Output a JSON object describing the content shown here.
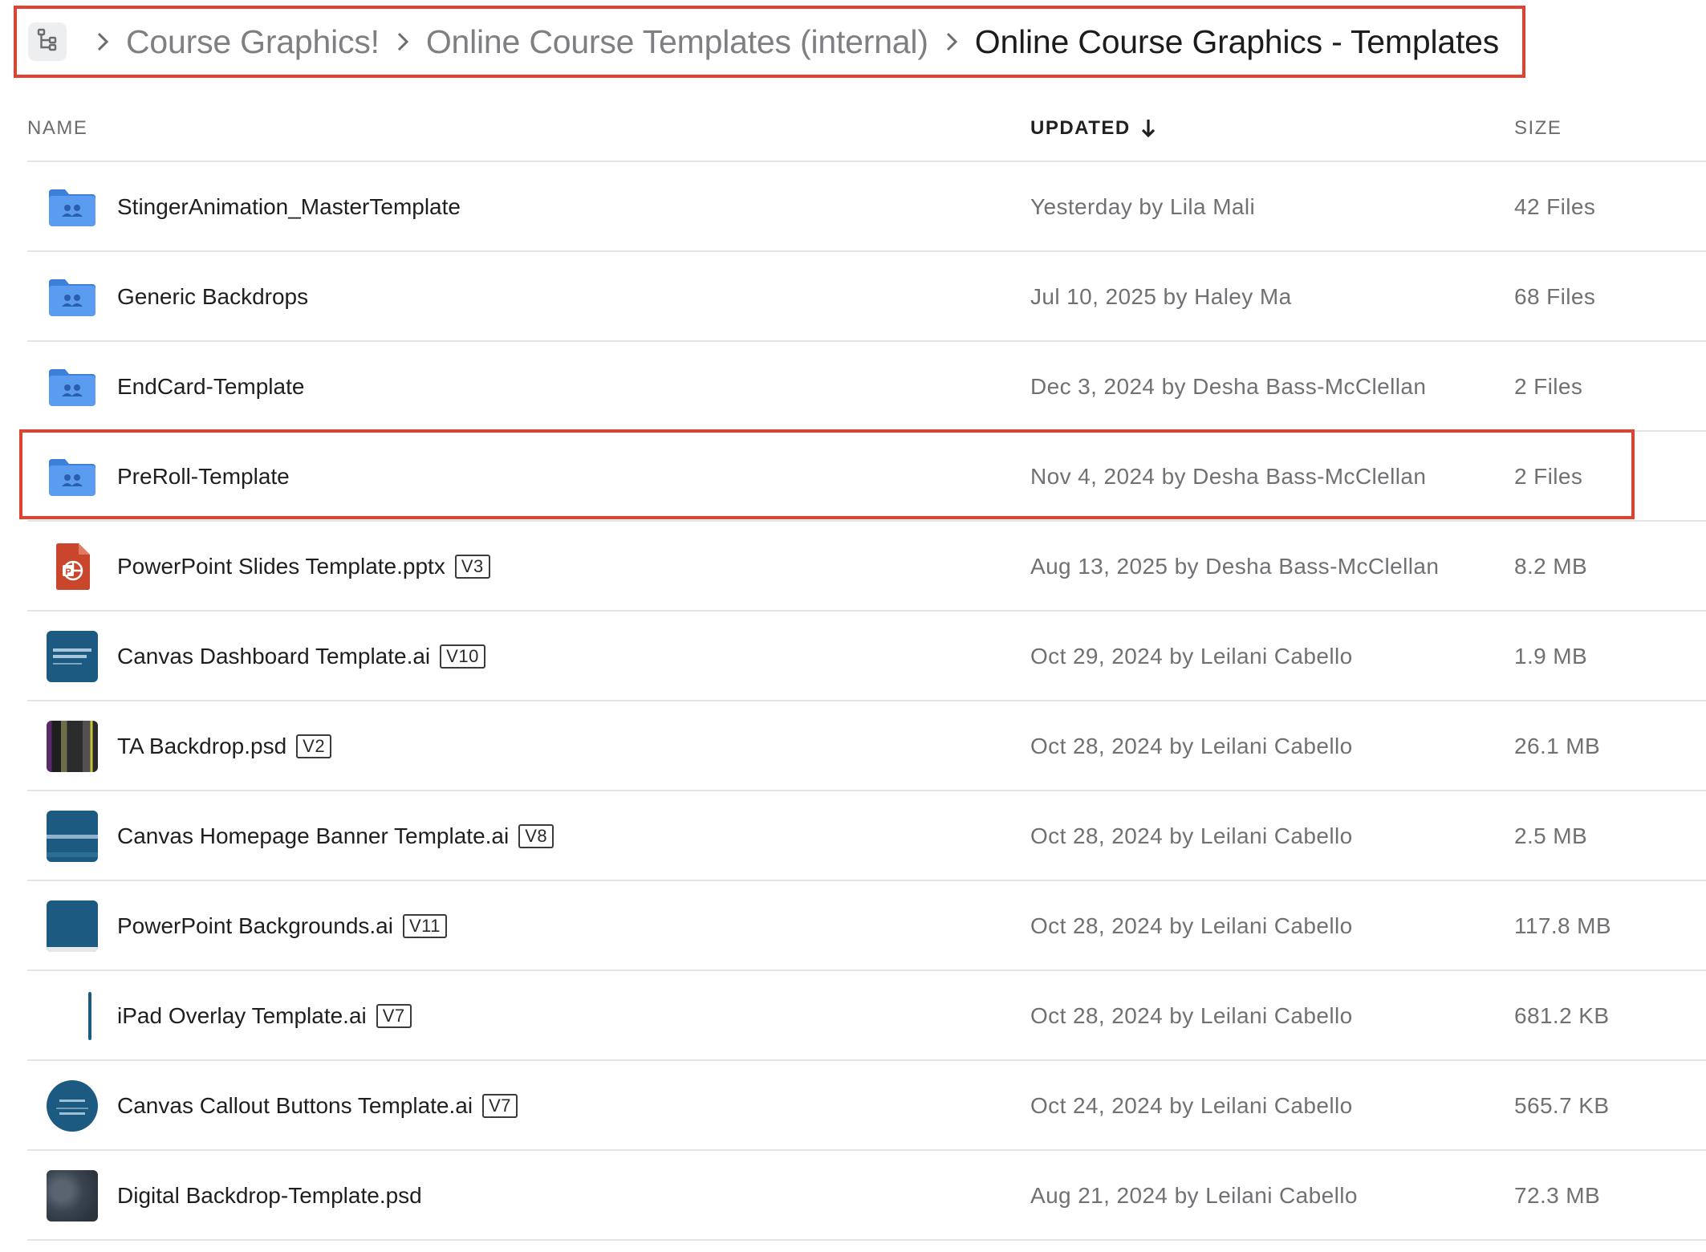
{
  "breadcrumb": {
    "items": [
      {
        "label": "Course Graphics!"
      },
      {
        "label": "Online Course Templates (internal)"
      },
      {
        "label": "Online Course Graphics - Templates"
      }
    ]
  },
  "columns": {
    "name": "NAME",
    "updated": "UPDATED",
    "size": "SIZE"
  },
  "rows": [
    {
      "name": "StingerAnimation_MasterTemplate",
      "version": "",
      "updated": "Yesterday by Lila Mali",
      "size": "42 Files",
      "icon": "shared-folder-icon"
    },
    {
      "name": "Generic Backdrops",
      "version": "",
      "updated": "Jul 10, 2025 by Haley Ma",
      "size": "68 Files",
      "icon": "shared-folder-icon"
    },
    {
      "name": "EndCard-Template",
      "version": "",
      "updated": "Dec 3, 2024 by Desha Bass-McClellan",
      "size": "2 Files",
      "icon": "shared-folder-icon"
    },
    {
      "name": "PreRoll-Template",
      "version": "",
      "updated": "Nov 4, 2024 by Desha Bass-McClellan",
      "size": "2 Files",
      "icon": "shared-folder-icon",
      "highlighted": true
    },
    {
      "name": "PowerPoint Slides Template.pptx",
      "version": "V3",
      "updated": "Aug 13, 2025 by Desha Bass-McClellan",
      "size": "8.2 MB",
      "icon": "powerpoint-file-icon"
    },
    {
      "name": "Canvas Dashboard Template.ai",
      "version": "V10",
      "updated": "Oct 29, 2024 by Leilani Cabello",
      "size": "1.9 MB",
      "icon": "file-thumbnail"
    },
    {
      "name": "TA Backdrop.psd",
      "version": "V2",
      "updated": "Oct 28, 2024 by Leilani Cabello",
      "size": "26.1 MB",
      "icon": "file-thumbnail"
    },
    {
      "name": "Canvas Homepage Banner Template.ai",
      "version": "V8",
      "updated": "Oct 28, 2024 by Leilani Cabello",
      "size": "2.5 MB",
      "icon": "file-thumbnail"
    },
    {
      "name": "PowerPoint Backgrounds.ai",
      "version": "V11",
      "updated": "Oct 28, 2024 by Leilani Cabello",
      "size": "117.8 MB",
      "icon": "file-thumbnail"
    },
    {
      "name": "iPad Overlay Template.ai",
      "version": "V7",
      "updated": "Oct 28, 2024 by Leilani Cabello",
      "size": "681.2 KB",
      "icon": "file-thumbnail"
    },
    {
      "name": "Canvas Callout Buttons Template.ai",
      "version": "V7",
      "updated": "Oct 24, 2024 by Leilani Cabello",
      "size": "565.7 KB",
      "icon": "file-thumbnail"
    },
    {
      "name": "Digital Backdrop-Template.psd",
      "version": "",
      "updated": "Aug 21, 2024 by Leilani Cabello",
      "size": "72.3 MB",
      "icon": "file-thumbnail"
    }
  ],
  "colors": {
    "highlight": "#e2412f",
    "folder": "#4a90e2",
    "thumbnail_blue": "#1d5a82"
  }
}
